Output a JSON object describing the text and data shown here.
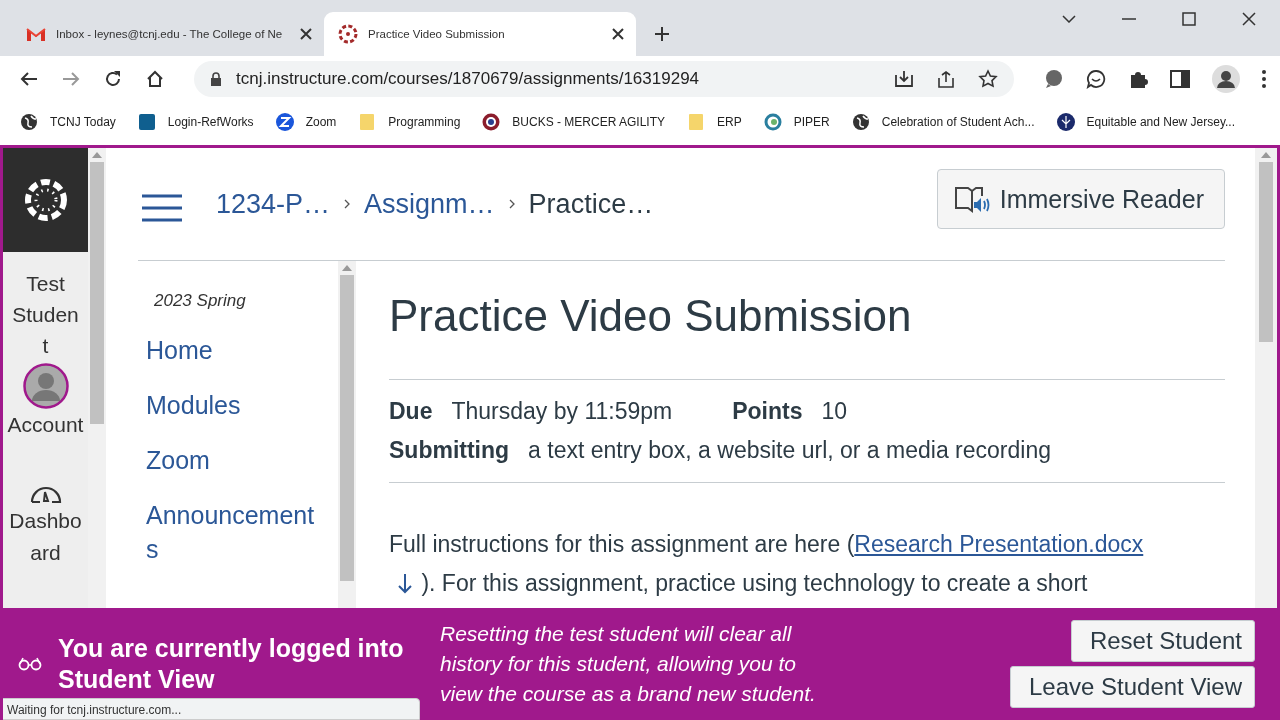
{
  "browser": {
    "tabs": [
      {
        "title": "Inbox - leynes@tcnj.edu - The College of Ne",
        "selected": false
      },
      {
        "title": "Practice Video Submission",
        "selected": true
      }
    ],
    "url": "tcnj.instructure.com/courses/1870679/assignments/16319294",
    "bookmarks": [
      {
        "label": "TCNJ Today"
      },
      {
        "label": "Login-RefWorks"
      },
      {
        "label": "Zoom"
      },
      {
        "label": "Programming"
      },
      {
        "label": "BUCKS - MERCER AGILITY"
      },
      {
        "label": "ERP"
      },
      {
        "label": "PIPER"
      },
      {
        "label": "Celebration of Student Ach..."
      },
      {
        "label": "Equitable and New Jersey..."
      }
    ],
    "status": "Waiting for tcnj.instructure.com..."
  },
  "global_nav": {
    "user_name": "Test Student",
    "items": [
      {
        "label": "Account"
      },
      {
        "label": "Dashboard"
      }
    ]
  },
  "breadcrumbs": [
    "1234-P…",
    "Assignm…",
    "Practice…"
  ],
  "immersive_reader": "Immersive Reader",
  "course_nav": {
    "term": "2023 Spring",
    "items": [
      {
        "label": "Home"
      },
      {
        "label": "Modules"
      },
      {
        "label": "Zoom"
      },
      {
        "label": "Announcements"
      }
    ]
  },
  "assignment": {
    "title": "Practice Video Submission",
    "details": [
      {
        "label": "Due",
        "value": "Thursday by 11:59pm"
      },
      {
        "label": "Points",
        "value": "10"
      },
      {
        "label": "Submitting",
        "value": "a text entry box, a website url, or a media recording"
      }
    ],
    "instructions": {
      "before": "Full instructions for this assignment are here (",
      "link": "Research Presentation.docx",
      "after": "). For this assignment, practice using technology to create a short"
    }
  },
  "student_view_banner": {
    "heading": "You are currently logged into Student View",
    "note": "Resetting the test student will clear all history for this student, allowing you to view the course as a brand new student.",
    "buttons": [
      "Reset Student",
      "Leave Student View"
    ]
  }
}
